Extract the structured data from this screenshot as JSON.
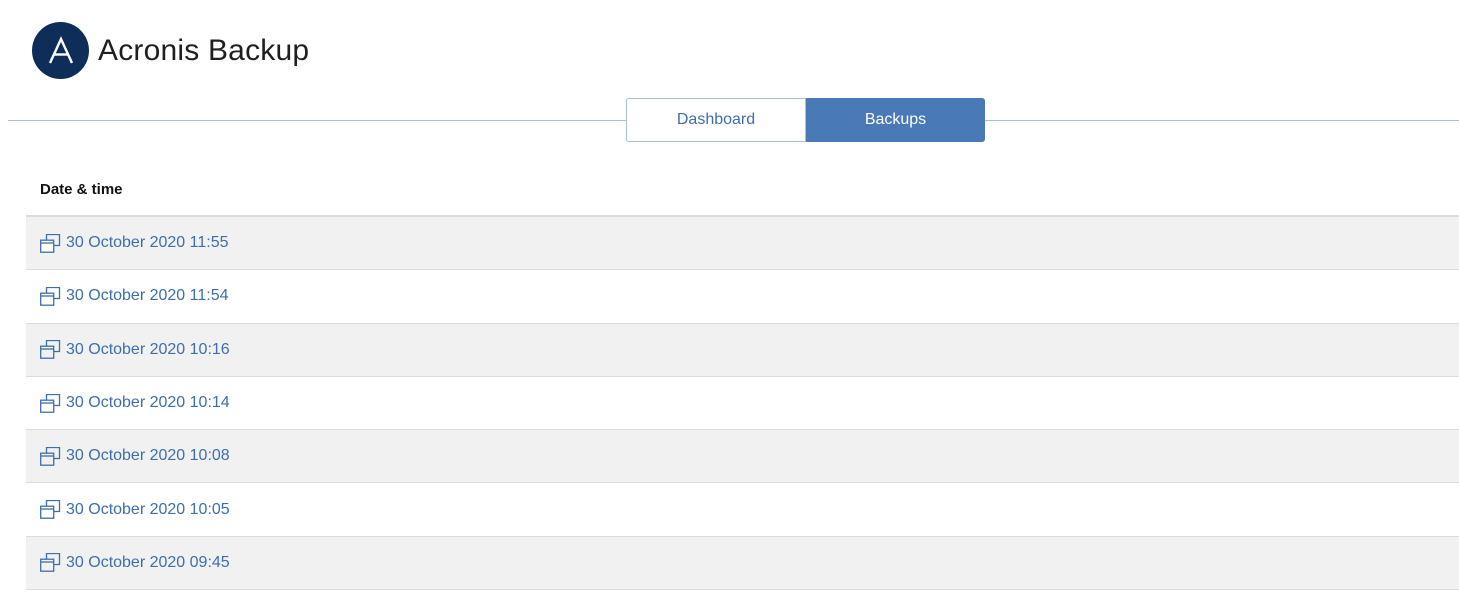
{
  "app": {
    "title": "Acronis Backup",
    "logo_letter": "A",
    "logo_color": "#0f2d59"
  },
  "tabs": [
    {
      "label": "Dashboard",
      "active": false
    },
    {
      "label": "Backups",
      "active": true
    }
  ],
  "colors": {
    "accent": "#4a79b7",
    "link": "#3e6eab",
    "row_shade": "#f1f1f1"
  },
  "table": {
    "columns": [
      "Date & time"
    ],
    "row_icon": "restore-copy-icon",
    "rows": [
      "30 October 2020 11:55",
      "30 October 2020 11:54",
      "30 October 2020 10:16",
      "30 October 2020 10:14",
      "30 October 2020 10:08",
      "30 October 2020 10:05",
      "30 October 2020 09:45"
    ]
  }
}
